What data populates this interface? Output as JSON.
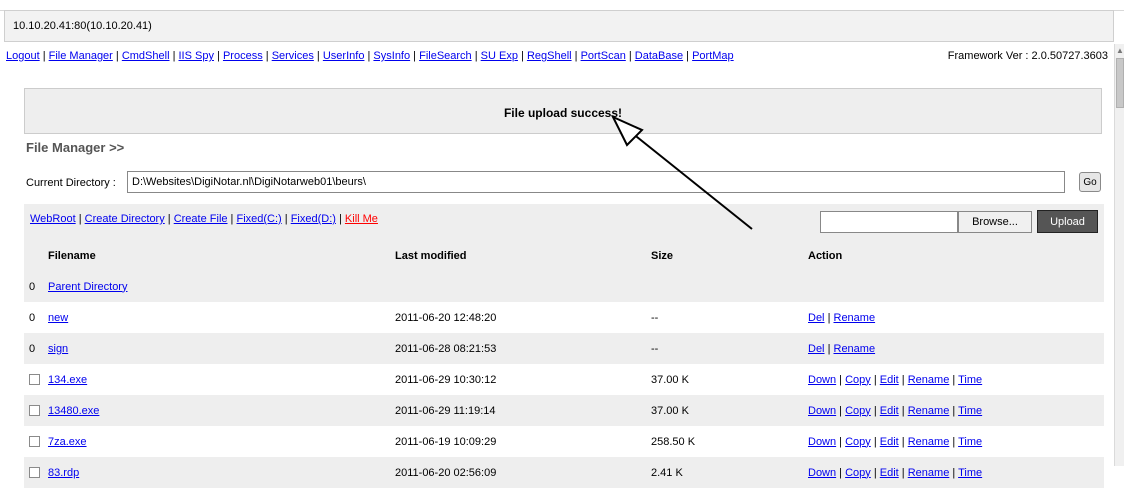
{
  "address": "10.10.20.41:80(10.10.20.41)",
  "nav": {
    "links": [
      "Logout",
      "File Manager",
      "CmdShell",
      "IIS Spy",
      "Process",
      "Services",
      "UserInfo",
      "SysInfo",
      "FileSearch",
      "SU Exp",
      "RegShell",
      "PortScan",
      "DataBase",
      "PortMap"
    ],
    "separator": " | ",
    "framework": "Framework Ver : 2.0.50727.3603"
  },
  "message": "File upload success!",
  "file_manager": {
    "title": "File Manager >>",
    "current_dir_label": "Current Directory :",
    "current_dir_value": "D:\\Websites\\DigiNotar.nl\\DigiNotarweb01\\beurs\\",
    "go_label": "Go"
  },
  "actions": {
    "links": [
      "WebRoot",
      "Create Directory",
      "Create File",
      "Fixed(C:)",
      "Fixed(D:)",
      "Kill Me"
    ],
    "browse_label": "Browse...",
    "upload_label": "Upload"
  },
  "table": {
    "headers": [
      "Filename",
      "Last modified",
      "Size",
      "Action"
    ],
    "rows": [
      {
        "marker": "0",
        "name": "Parent Directory",
        "modified": "",
        "size": "",
        "actions": []
      },
      {
        "marker": "0",
        "name": "new",
        "modified": "2011-06-20 12:48:20",
        "size": "--",
        "actions": [
          "Del",
          "Rename"
        ]
      },
      {
        "marker": "0",
        "name": "sign",
        "modified": "2011-06-28 08:21:53",
        "size": "--",
        "actions": [
          "Del",
          "Rename"
        ]
      },
      {
        "marker": "checkbox",
        "name": "134.exe",
        "modified": "2011-06-29 10:30:12",
        "size": "37.00 K",
        "actions": [
          "Down",
          "Copy",
          "Edit",
          "Rename",
          "Time"
        ]
      },
      {
        "marker": "checkbox",
        "name": "13480.exe",
        "modified": "2011-06-29 11:19:14",
        "size": "37.00 K",
        "actions": [
          "Down",
          "Copy",
          "Edit",
          "Rename",
          "Time"
        ]
      },
      {
        "marker": "checkbox",
        "name": "7za.exe",
        "modified": "2011-06-19 10:09:29",
        "size": "258.50 K",
        "actions": [
          "Down",
          "Copy",
          "Edit",
          "Rename",
          "Time"
        ]
      },
      {
        "marker": "checkbox",
        "name": "83.rdp",
        "modified": "2011-06-20 02:56:09",
        "size": "2.41 K",
        "actions": [
          "Down",
          "Copy",
          "Edit",
          "Rename",
          "Time"
        ]
      }
    ]
  },
  "colors": {
    "link": "#0000ee",
    "kill_link": "#ff0000",
    "panel_bg": "#eeeeee",
    "upload_button": "#555555"
  }
}
